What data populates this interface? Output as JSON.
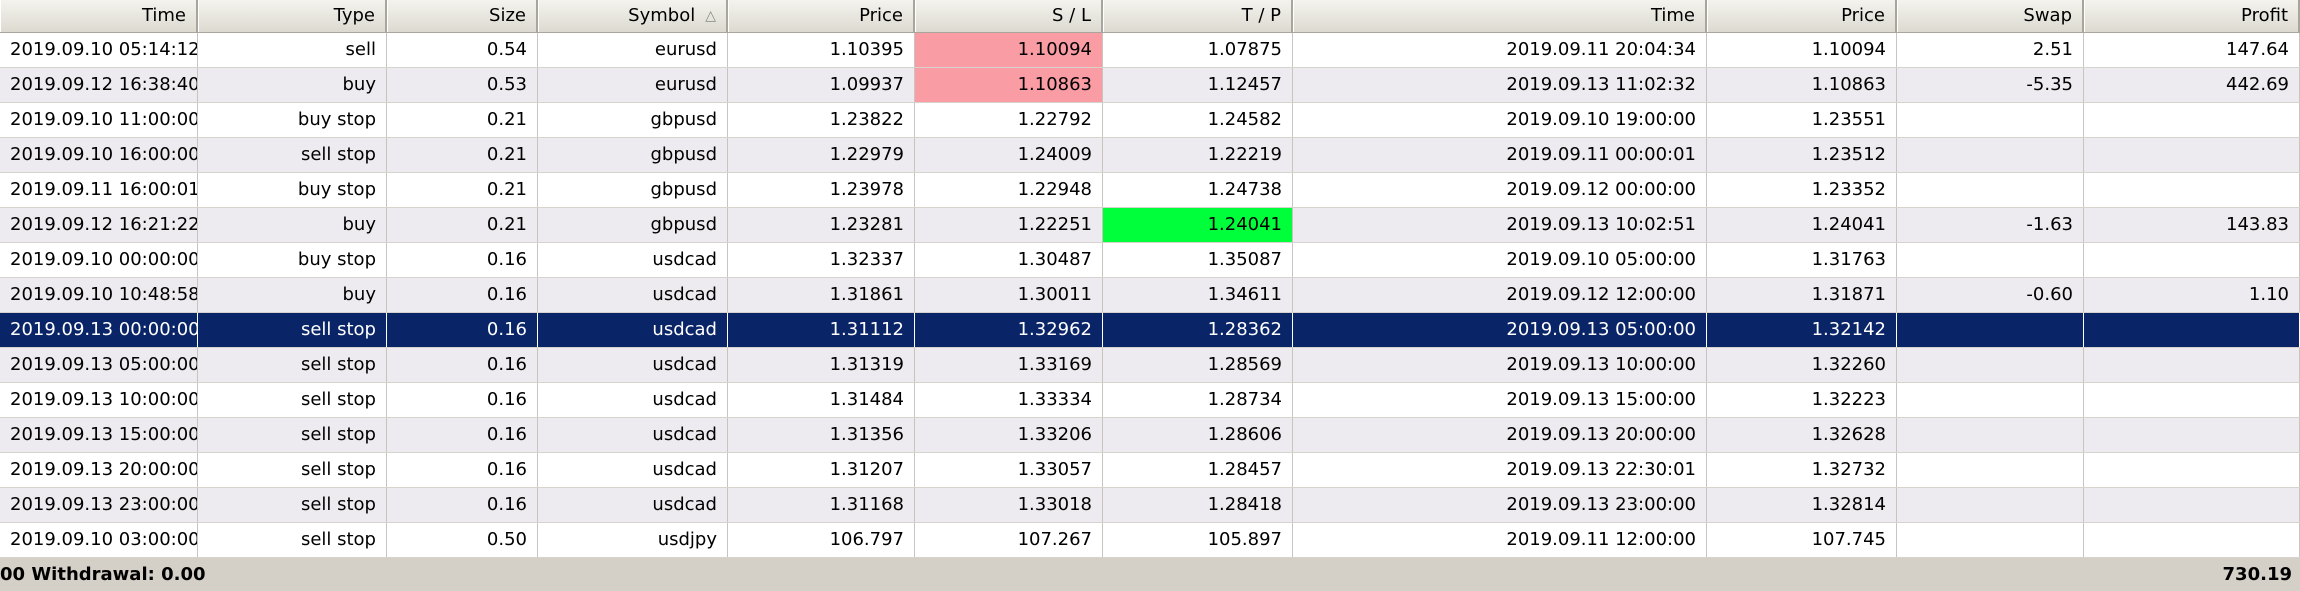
{
  "columns": [
    "Time",
    "Type",
    "Size",
    "Symbol",
    "Price",
    "S / L",
    "T / P",
    "Time",
    "Price",
    "Swap",
    "Profit"
  ],
  "rows": [
    {
      "open_time": "2019.09.10 05:14:12",
      "type": "sell",
      "size": "0.54",
      "symbol": "eurusd",
      "price": "1.10395",
      "sl": "1.10094",
      "tp": "1.07875",
      "close_time": "2019.09.11 20:04:34",
      "close_price": "1.10094",
      "swap": "2.51",
      "profit": "147.64",
      "highlight": "sl"
    },
    {
      "open_time": "2019.09.12 16:38:40",
      "type": "buy",
      "size": "0.53",
      "symbol": "eurusd",
      "price": "1.09937",
      "sl": "1.10863",
      "tp": "1.12457",
      "close_time": "2019.09.13 11:02:32",
      "close_price": "1.10863",
      "swap": "-5.35",
      "profit": "442.69",
      "highlight": "sl"
    },
    {
      "open_time": "2019.09.10 11:00:00",
      "type": "buy stop",
      "size": "0.21",
      "symbol": "gbpusd",
      "price": "1.23822",
      "sl": "1.22792",
      "tp": "1.24582",
      "close_time": "2019.09.10 19:00:00",
      "close_price": "1.23551",
      "swap": "",
      "profit": "",
      "highlight": ""
    },
    {
      "open_time": "2019.09.10 16:00:00",
      "type": "sell stop",
      "size": "0.21",
      "symbol": "gbpusd",
      "price": "1.22979",
      "sl": "1.24009",
      "tp": "1.22219",
      "close_time": "2019.09.11 00:00:01",
      "close_price": "1.23512",
      "swap": "",
      "profit": "",
      "highlight": ""
    },
    {
      "open_time": "2019.09.11 16:00:01",
      "type": "buy stop",
      "size": "0.21",
      "symbol": "gbpusd",
      "price": "1.23978",
      "sl": "1.22948",
      "tp": "1.24738",
      "close_time": "2019.09.12 00:00:00",
      "close_price": "1.23352",
      "swap": "",
      "profit": "",
      "highlight": ""
    },
    {
      "open_time": "2019.09.12 16:21:22",
      "type": "buy",
      "size": "0.21",
      "symbol": "gbpusd",
      "price": "1.23281",
      "sl": "1.22251",
      "tp": "1.24041",
      "close_time": "2019.09.13 10:02:51",
      "close_price": "1.24041",
      "swap": "-1.63",
      "profit": "143.83",
      "highlight": "tp"
    },
    {
      "open_time": "2019.09.10 00:00:00",
      "type": "buy stop",
      "size": "0.16",
      "symbol": "usdcad",
      "price": "1.32337",
      "sl": "1.30487",
      "tp": "1.35087",
      "close_time": "2019.09.10 05:00:00",
      "close_price": "1.31763",
      "swap": "",
      "profit": "",
      "highlight": ""
    },
    {
      "open_time": "2019.09.10 10:48:58",
      "type": "buy",
      "size": "0.16",
      "symbol": "usdcad",
      "price": "1.31861",
      "sl": "1.30011",
      "tp": "1.34611",
      "close_time": "2019.09.12 12:00:00",
      "close_price": "1.31871",
      "swap": "-0.60",
      "profit": "1.10",
      "highlight": ""
    },
    {
      "open_time": "2019.09.13 00:00:00",
      "type": "sell stop",
      "size": "0.16",
      "symbol": "usdcad",
      "price": "1.31112",
      "sl": "1.32962",
      "tp": "1.28362",
      "close_time": "2019.09.13 05:00:00",
      "close_price": "1.32142",
      "swap": "",
      "profit": "",
      "highlight": "",
      "selected": true
    },
    {
      "open_time": "2019.09.13 05:00:00",
      "type": "sell stop",
      "size": "0.16",
      "symbol": "usdcad",
      "price": "1.31319",
      "sl": "1.33169",
      "tp": "1.28569",
      "close_time": "2019.09.13 10:00:00",
      "close_price": "1.32260",
      "swap": "",
      "profit": "",
      "highlight": ""
    },
    {
      "open_time": "2019.09.13 10:00:00",
      "type": "sell stop",
      "size": "0.16",
      "symbol": "usdcad",
      "price": "1.31484",
      "sl": "1.33334",
      "tp": "1.28734",
      "close_time": "2019.09.13 15:00:00",
      "close_price": "1.32223",
      "swap": "",
      "profit": "",
      "highlight": ""
    },
    {
      "open_time": "2019.09.13 15:00:00",
      "type": "sell stop",
      "size": "0.16",
      "symbol": "usdcad",
      "price": "1.31356",
      "sl": "1.33206",
      "tp": "1.28606",
      "close_time": "2019.09.13 20:00:00",
      "close_price": "1.32628",
      "swap": "",
      "profit": "",
      "highlight": ""
    },
    {
      "open_time": "2019.09.13 20:00:00",
      "type": "sell stop",
      "size": "0.16",
      "symbol": "usdcad",
      "price": "1.31207",
      "sl": "1.33057",
      "tp": "1.28457",
      "close_time": "2019.09.13 22:30:01",
      "close_price": "1.32732",
      "swap": "",
      "profit": "",
      "highlight": ""
    },
    {
      "open_time": "2019.09.13 23:00:00",
      "type": "sell stop",
      "size": "0.16",
      "symbol": "usdcad",
      "price": "1.31168",
      "sl": "1.33018",
      "tp": "1.28418",
      "close_time": "2019.09.13 23:00:00",
      "close_price": "1.32814",
      "swap": "",
      "profit": "",
      "highlight": ""
    },
    {
      "open_time": "2019.09.10 03:00:00",
      "type": "sell stop",
      "size": "0.50",
      "symbol": "usdjpy",
      "price": "106.797",
      "sl": "107.267",
      "tp": "105.897",
      "close_time": "2019.09.11 12:00:00",
      "close_price": "107.745",
      "swap": "",
      "profit": "",
      "highlight": ""
    }
  ],
  "footer": {
    "left_text": "00  Withdrawal: 0.00",
    "total_profit": "730.19"
  },
  "colors": {
    "sl_hit": "#f99ca4",
    "tp_hit": "#00ff3b",
    "selected_row": "#0a2468"
  },
  "icons": {
    "sort_indicator": "sort-asc-icon"
  }
}
